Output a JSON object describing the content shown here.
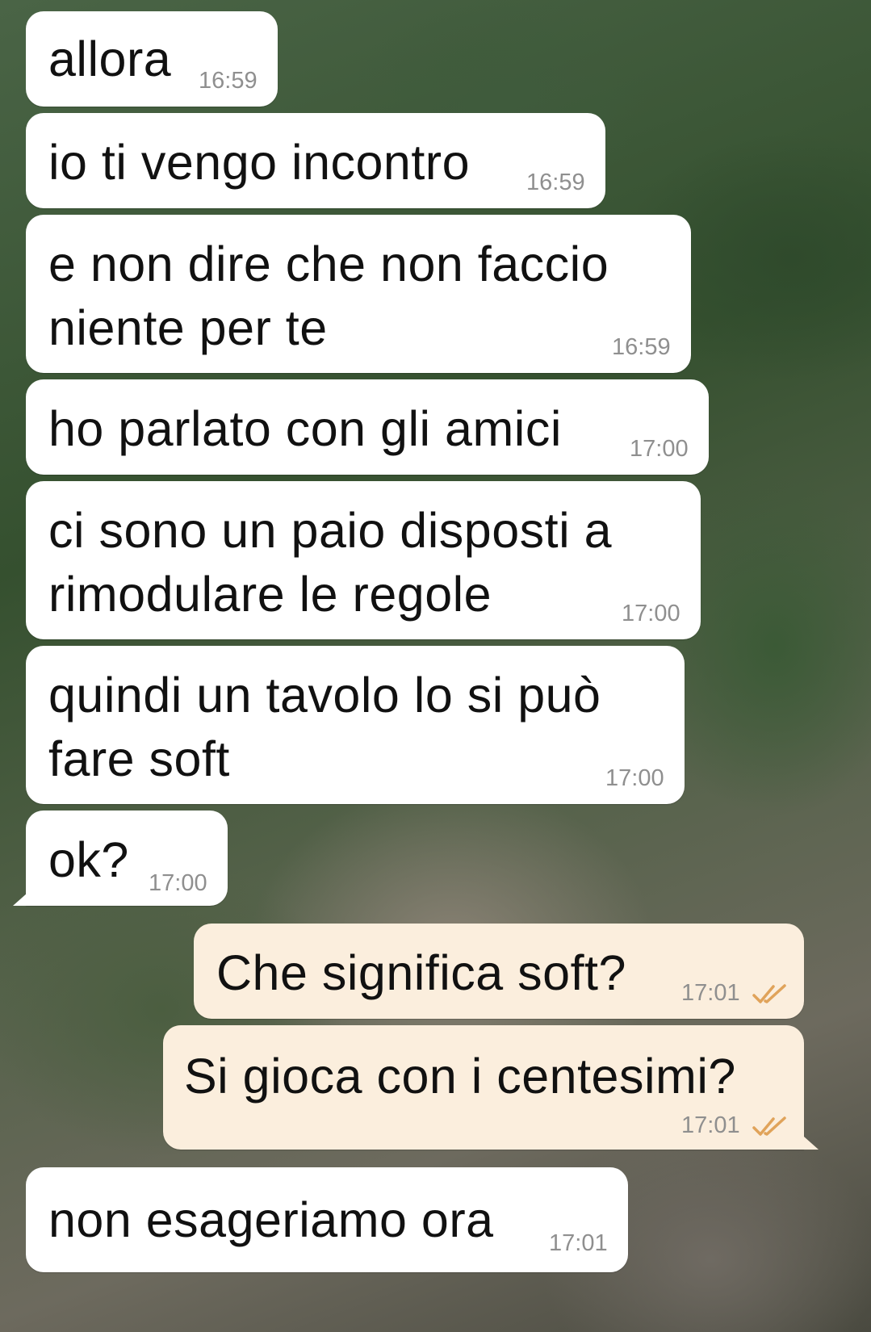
{
  "messages": [
    {
      "direction": "in",
      "text": "allora",
      "time": "16:59"
    },
    {
      "direction": "in",
      "text": "io ti vengo incontro",
      "time": "16:59"
    },
    {
      "direction": "in",
      "text": "e non dire che non faccio\nniente per te",
      "time": "16:59"
    },
    {
      "direction": "in",
      "text": "ho parlato con gli amici",
      "time": "17:00"
    },
    {
      "direction": "in",
      "text": "ci sono un paio disposti a\nrimodulare le regole",
      "time": "17:00"
    },
    {
      "direction": "in",
      "text": "quindi un tavolo lo si può\nfare soft",
      "time": "17:00"
    },
    {
      "direction": "in",
      "text": "ok?",
      "time": "17:00"
    },
    {
      "direction": "out",
      "text": "Che significa soft?",
      "time": "17:01",
      "status_icon": "double-check-read-icon"
    },
    {
      "direction": "out",
      "text": "Si gioca con i centesimi?",
      "time": "17:01",
      "status_icon": "double-check-read-icon"
    },
    {
      "direction": "in",
      "text": "non esageriamo ora",
      "time": "17:01"
    }
  ],
  "colors": {
    "incoming_bubble": "#ffffff",
    "outgoing_bubble": "#fbeedd",
    "timestamp": "#8f8f8f",
    "read_ticks": "#e0a35a",
    "text": "#111111"
  }
}
